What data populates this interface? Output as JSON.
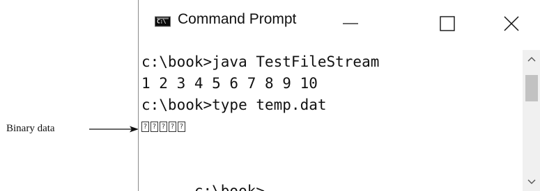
{
  "annotation": {
    "label": "Binary data"
  },
  "window": {
    "title": "Command Prompt",
    "icon_text": "C:\\",
    "controls": [
      "minimize-icon",
      "maximize-icon",
      "close-icon"
    ]
  },
  "console": {
    "line1": "c:\\book>java TestFileStream",
    "line2": "1 2 3 4 5 6 7 8 9 10",
    "line3": "c:\\book>type temp.dat",
    "binary_glyphs": [
      "?",
      "?",
      "?",
      "?",
      "?"
    ],
    "prompt": "c:\\book>"
  }
}
